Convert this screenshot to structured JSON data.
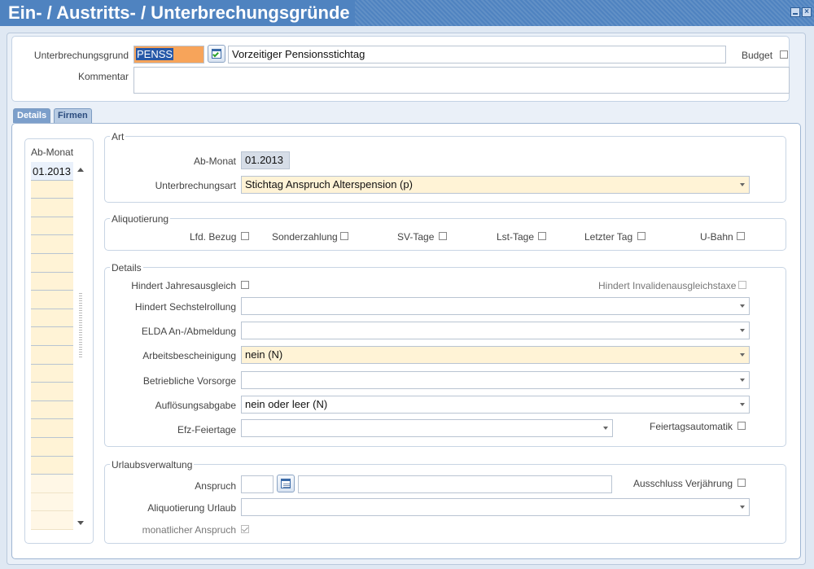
{
  "window": {
    "title": "Ein- / Austritts- / Unterbrechungsgründe"
  },
  "header": {
    "unterbrechungsgrund_label": "Unterbrechungsgrund",
    "unterbrechungsgrund_code": "PENSS",
    "unterbrechungsgrund_text": "Vorzeitiger Pensionsstichtag",
    "budget_label": "Budget",
    "kommentar_label": "Kommentar",
    "kommentar_value": ""
  },
  "tabs": [
    {
      "label": "Details"
    },
    {
      "label": "Firmen"
    }
  ],
  "ab_monat_list": {
    "header": "Ab-Monat",
    "items": [
      "01.2013"
    ]
  },
  "art": {
    "title": "Art",
    "ab_monat_label": "Ab-Monat",
    "ab_monat_value": "01.2013",
    "unterbrechungsart_label": "Unterbrechungsart",
    "unterbrechungsart_value": "Stichtag Anspruch Alterspension (p)"
  },
  "aliquotierung": {
    "title": "Aliquotierung",
    "items": [
      "Lfd. Bezug",
      "Sonderzahlung",
      "SV-Tage",
      "Lst-Tage",
      "Letzter Tag",
      "U-Bahn"
    ]
  },
  "details": {
    "title": "Details",
    "hindert_jahresausgleich_label": "Hindert Jahresausgleich",
    "hindert_invalidenausgleichstaxe_label": "Hindert Invalidenausgleichstaxe",
    "hindert_sechstelrollung_label": "Hindert Sechstelrollung",
    "hindert_sechstelrollung_value": "",
    "elda_label": "ELDA An-/Abmeldung",
    "elda_value": "",
    "arbeitsbescheinigung_label": "Arbeitsbescheinigung",
    "arbeitsbescheinigung_value": "nein (N)",
    "betriebliche_vorsorge_label": "Betriebliche Vorsorge",
    "betriebliche_vorsorge_value": "",
    "aufloesungsabgabe_label": "Auflösungsabgabe",
    "aufloesungsabgabe_value": "nein oder leer (N)",
    "efz_feiertage_label": "Efz-Feiertage",
    "efz_feiertage_value": "",
    "feiertagsautomatik_label": "Feiertagsautomatik"
  },
  "urlaub": {
    "title": "Urlaubsverwaltung",
    "anspruch_label": "Anspruch",
    "anspruch_value": "",
    "anspruch_text": "",
    "ausschluss_label": "Ausschluss Verjährung",
    "aliquotierung_urlaub_label": "Aliquotierung Urlaub",
    "aliquotierung_urlaub_value": "",
    "monatlicher_anspruch_label": "monatlicher Anspruch"
  }
}
